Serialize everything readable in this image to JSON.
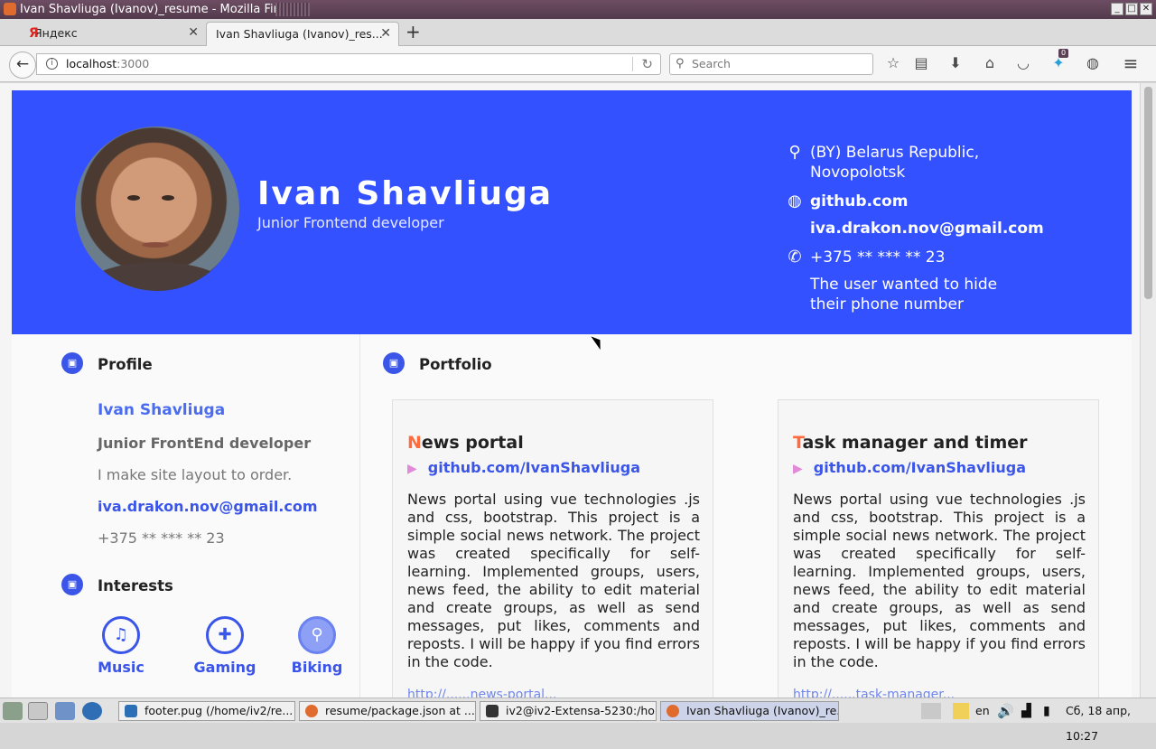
{
  "window": {
    "title": "Ivan Shavliuga (Ivanov)_resume - Mozilla Firefox"
  },
  "tabs": [
    {
      "label": "Яндекс",
      "favicon": "Я"
    },
    {
      "label": "Ivan Shavliuga (Ivanov)_res..."
    }
  ],
  "navbar": {
    "url_host": "localhost",
    "url_port": ":3000",
    "search_placeholder": "Search",
    "badge_count": "0"
  },
  "resume": {
    "name": "Ivan Shavliuga",
    "role": "Junior Frontend developer",
    "contacts": {
      "location_line1": "(BY) Belarus Republic,",
      "location_line2": "Novopolotsk",
      "website": "github.com",
      "email": "iva.drakon.nov@gmail.com",
      "phone": "+375 ** *** ** 23",
      "phone_note_line1": "The user wanted to hide",
      "phone_note_line2": "their phone number"
    },
    "profile": {
      "title": "Profile",
      "name": "Ivan Shavliuga",
      "role": "Junior FrontEnd developer",
      "tagline": "I make site layout to order.",
      "email": "iva.drakon.nov@gmail.com",
      "phone": "+375 ** *** ** 23"
    },
    "interests": {
      "title": "Interests",
      "items": [
        {
          "label": "Music",
          "icon": "headphones-icon"
        },
        {
          "label": "Gaming",
          "icon": "gamepad-icon"
        },
        {
          "label": "Biking",
          "icon": "bike-icon"
        }
      ]
    },
    "portfolio": {
      "title": "Portfolio",
      "projects": [
        {
          "initial": "N",
          "title_rest": "ews portal",
          "link": "github.com/IvanShavliuga",
          "description": "News portal using vue technologies .js and css, bootstrap. This project is a simple social news network. The project was created specifically for self- learning. Implemented groups, users, news feed, the ability to edit material and create groups, as well as send messages, put likes, comments and reposts. I will be happy if you find errors in the code.",
          "extra_link": "http://......news-portal..."
        },
        {
          "initial": "T",
          "title_rest": "ask manager and timer",
          "link": "github.com/IvanShavliuga",
          "description": "News portal using vue technologies .js and css, bootstrap. This project is a simple social news network. The project was created specifically for self- learning. Implemented groups, users, news feed, the ability to edit material and create groups, as well as send messages, put likes, comments and reposts. I will be happy if you find errors in the code.",
          "extra_link": "http://......task-manager..."
        }
      ]
    }
  },
  "taskbar": {
    "tasks": [
      {
        "label": "footer.pug (/home/iv2/re..."
      },
      {
        "label": "resume/package.json at ..."
      },
      {
        "label": "iv2@iv2-Extensa-5230:/ho..."
      },
      {
        "label": "Ivan Shavliuga (Ivanov)_re..."
      }
    ],
    "lang": "en",
    "clock": "Сб, 18 апр, 10:27"
  },
  "colors": {
    "hero_bg": "#3451ff",
    "accent": "#3a55e8",
    "initial": "#ff6b3d",
    "titlebar": "#533a4c"
  }
}
